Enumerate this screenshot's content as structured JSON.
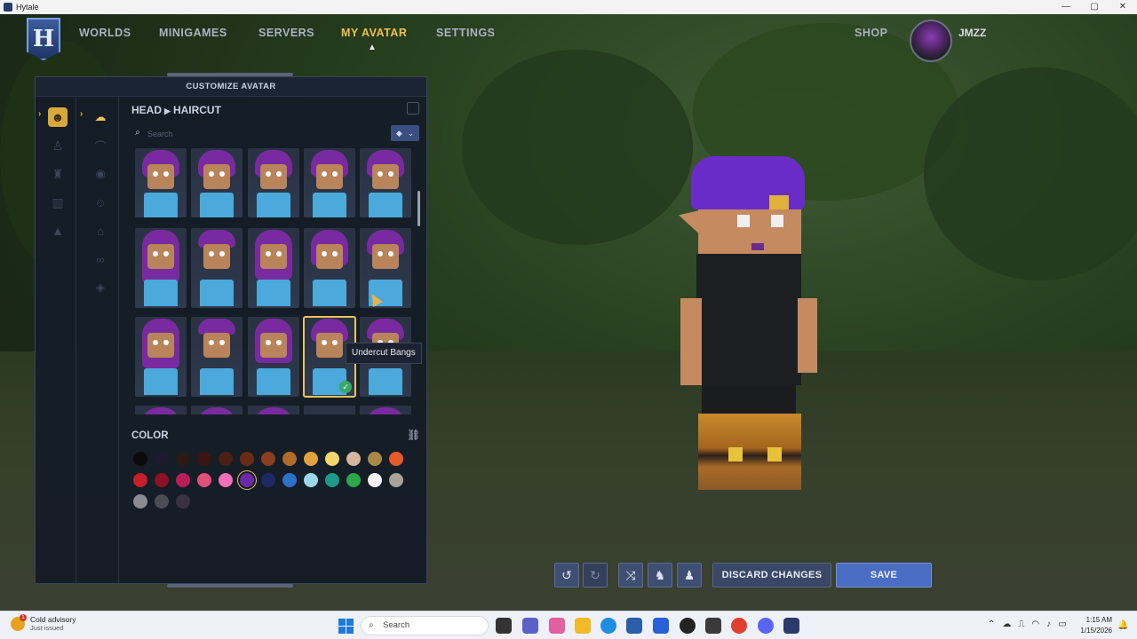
{
  "window": {
    "title": "Hytale",
    "controls": [
      "—",
      "▢",
      "✕"
    ]
  },
  "nav": {
    "items": [
      {
        "label": "WORLDS",
        "active": false
      },
      {
        "label": "MINIGAMES",
        "active": false
      },
      {
        "label": "SERVERS",
        "active": false
      },
      {
        "label": "MY AVATAR",
        "active": true
      },
      {
        "label": "SETTINGS",
        "active": false
      }
    ],
    "shop": "SHOP",
    "username": "JMZZ",
    "logo": "H"
  },
  "panel": {
    "header": "CUSTOMIZE AVATAR",
    "breadcrumb": {
      "section": "HEAD",
      "subsection": "HAIRCUT"
    },
    "search_placeholder": "Search",
    "selected_tile_tooltip": "Undercut Bangs",
    "color_title": "COLOR"
  },
  "colors": {
    "accent": "#f0c050",
    "save": "#4a6cc2",
    "swatches_row1": [
      "#0b0b0b",
      "#1c1a2e",
      "#2a1a14",
      "#3a1612",
      "#4a1f14",
      "#6a2b16",
      "#8a3e1e",
      "#b06a2a",
      "#e0a23a",
      "#f2d86a",
      "#d7b49c",
      "#a88a46",
      "#e85a2a"
    ],
    "swatches_row2": [
      "#c81e2a",
      "#8a1222",
      "#b81e5a",
      "#e0507a",
      "#f070b8",
      "#6a2aa8",
      "#1e2a66",
      "#2a72c6",
      "#9ad8e8",
      "#1e9a8a",
      "#2aa84a",
      "#f4f4f4",
      "#a8a49a"
    ],
    "swatches_row3": [
      "#8a8c92",
      "#4a4c56",
      "#3a3242"
    ],
    "selected_swatch_index_row2": 5
  },
  "bottom_bar": {
    "undo_icon": "undo-icon",
    "redo_icon": "redo-icon",
    "shuffle_icon": "shuffle-icon",
    "discard_label": "DISCARD CHANGES",
    "save_label": "SAVE"
  },
  "taskbar": {
    "weather_title": "Cold advisory",
    "weather_sub": "Just issued",
    "weather_badge": "1",
    "search_label": "Search",
    "time": "1:15 AM",
    "date": "1/15/2026"
  }
}
